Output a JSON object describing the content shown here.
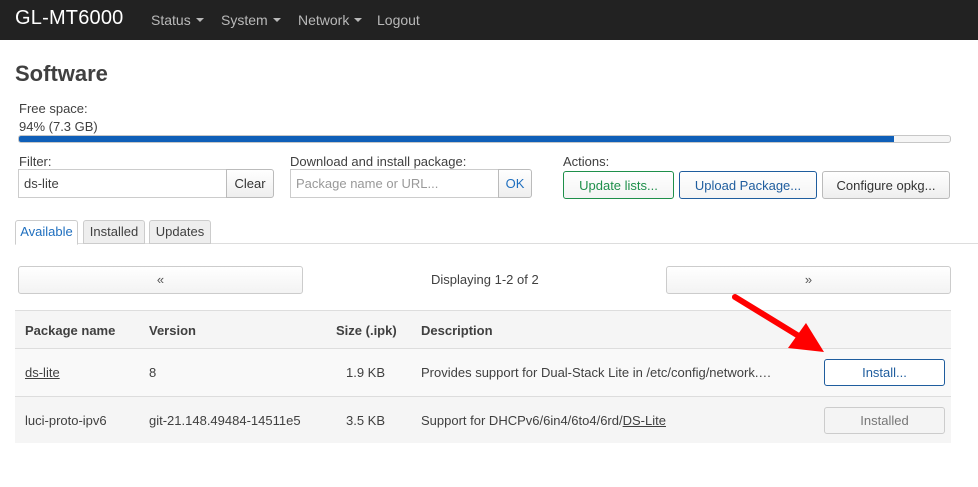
{
  "header": {
    "brand": "GL-MT6000",
    "menu": [
      {
        "label": "Status",
        "has_dropdown": true
      },
      {
        "label": "System",
        "has_dropdown": true
      },
      {
        "label": "Network",
        "has_dropdown": true
      },
      {
        "label": "Logout",
        "has_dropdown": false
      }
    ]
  },
  "page": {
    "title": "Software",
    "free_space_label": "Free space:",
    "free_space_value": "94% (7.3 GB)",
    "free_space_percent": 94
  },
  "filter": {
    "label": "Filter:",
    "value": "ds-lite",
    "clear_label": "Clear"
  },
  "download": {
    "label": "Download and install package:",
    "placeholder": "Package name or URL...",
    "ok_label": "OK"
  },
  "actions": {
    "label": "Actions:",
    "update_lists": "Update lists...",
    "upload_package": "Upload Package...",
    "configure_opkg": "Configure opkg..."
  },
  "tabs": [
    {
      "label": "Available",
      "active": true
    },
    {
      "label": "Installed",
      "active": false
    },
    {
      "label": "Updates",
      "active": false
    }
  ],
  "pager": {
    "prev": "«",
    "info": "Displaying 1-2 of 2",
    "next": "»"
  },
  "table": {
    "headers": [
      "Package name",
      "Version",
      "Size (.ipk)",
      "Description"
    ],
    "rows": [
      {
        "name": "ds-lite",
        "version": "8",
        "size": "1.9 KB",
        "description": "Provides support for Dual-Stack Lite in /etc/config/network.…",
        "action": "Install..."
      },
      {
        "name": "luci-proto-ipv6",
        "version": "git-21.148.49484-14511e5",
        "size": "3.5 KB",
        "description_prefix": "Support for DHCPv6/6in4/6to4/6rd/",
        "description_link": "DS-Lite",
        "action": "Installed"
      }
    ]
  },
  "colors": {
    "navbar": "#222222",
    "progress": "#0f5fb8",
    "update_lists_border": "#1e8f4a",
    "primary_border": "#1f5d9e",
    "annotation_arrow": "#ff0000"
  }
}
